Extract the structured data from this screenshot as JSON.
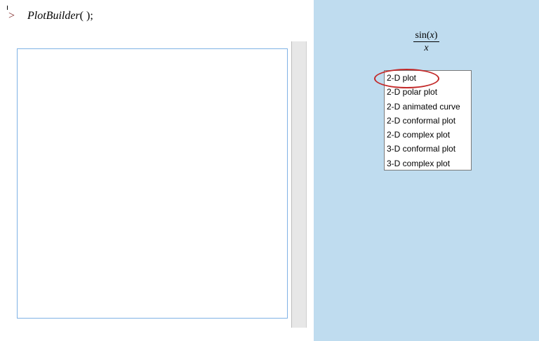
{
  "command_line": {
    "prompt": ">",
    "command_name": "PlotBuilder",
    "command_args": "( );"
  },
  "expression": {
    "numerator_func": "sin(",
    "numerator_var": "x",
    "numerator_close": ")",
    "denominator": "x"
  },
  "context_menu": {
    "items": [
      "2-D plot",
      "2-D polar plot",
      "2-D animated curve",
      "2-D conformal plot",
      "2-D complex plot",
      "3-D conformal plot",
      "3-D complex plot"
    ],
    "highlighted_index": 0
  },
  "colors": {
    "panel_background": "#bfdcef",
    "highlight_ring": "#c32a2a",
    "prompt": "#7a1f1f"
  }
}
